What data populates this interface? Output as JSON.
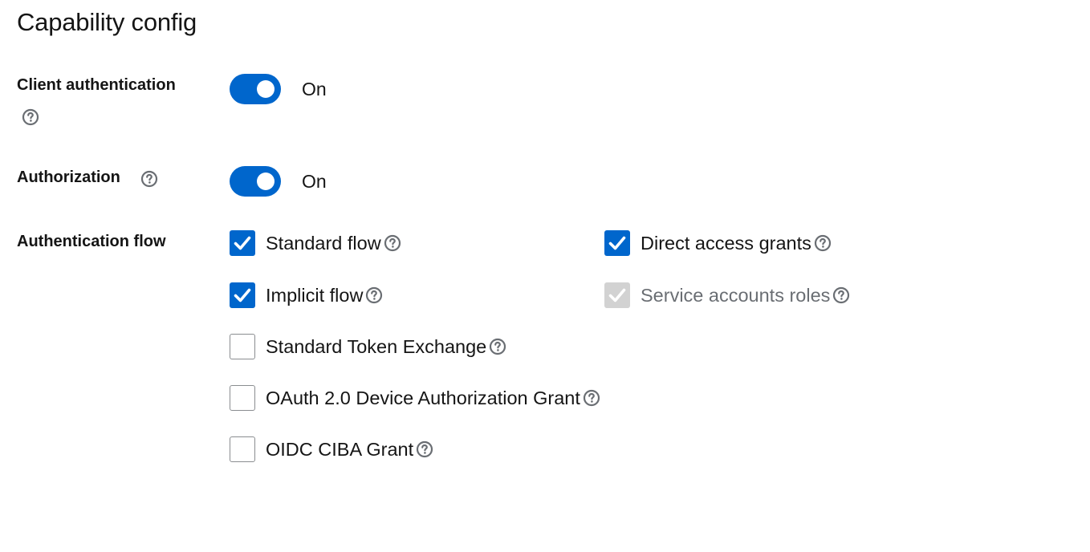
{
  "section": {
    "title": "Capability config"
  },
  "client_authentication": {
    "label": "Client authentication",
    "help_icon": "question-circle-icon",
    "state_text": "On",
    "enabled": true
  },
  "authorization": {
    "label": "Authorization",
    "help_icon": "question-circle-icon",
    "state_text": "On",
    "enabled": true
  },
  "authentication_flow": {
    "label": "Authentication flow",
    "options": [
      {
        "label": "Standard flow",
        "checked": true,
        "disabled": false
      },
      {
        "label": "Direct access grants",
        "checked": true,
        "disabled": false
      },
      {
        "label": "Implicit flow",
        "checked": true,
        "disabled": false
      },
      {
        "label": "Service accounts roles",
        "checked": true,
        "disabled": true
      },
      {
        "label": "Standard Token Exchange",
        "checked": false,
        "disabled": false
      },
      {
        "label": "OAuth 2.0 Device Authorization Grant",
        "checked": false,
        "disabled": false
      },
      {
        "label": "OIDC CIBA Grant",
        "checked": false,
        "disabled": false
      }
    ]
  },
  "colors": {
    "accent": "#0066cc",
    "disabled_box": "#d2d2d2",
    "disabled_text": "#6a6e73",
    "help_icon": "#6a6e73",
    "text": "#151515"
  }
}
